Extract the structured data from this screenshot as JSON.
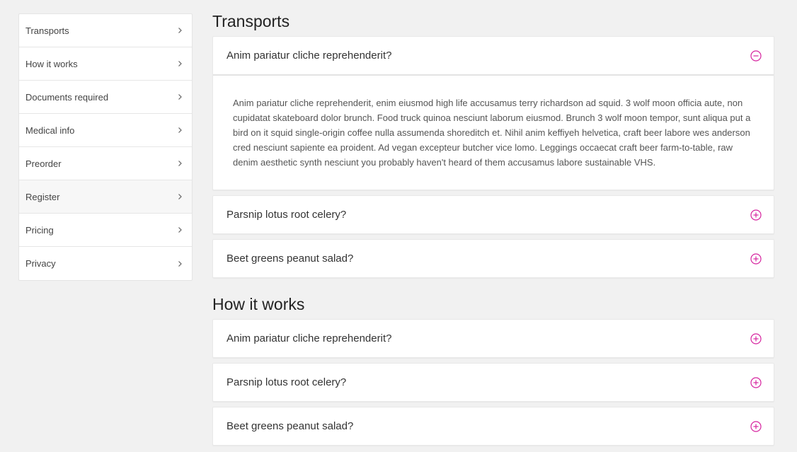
{
  "sidebar": {
    "items": [
      {
        "label": "Transports"
      },
      {
        "label": "How it works"
      },
      {
        "label": "Documents required"
      },
      {
        "label": "Medical info"
      },
      {
        "label": "Preorder"
      },
      {
        "label": "Register"
      },
      {
        "label": "Pricing"
      },
      {
        "label": "Privacy"
      }
    ]
  },
  "accent_color": "#d6249f",
  "sections": [
    {
      "title": "Transports",
      "faqs": [
        {
          "question": "Anim pariatur cliche reprehenderit?",
          "expanded": true,
          "answer": "Anim pariatur cliche reprehenderit, enim eiusmod high life accusamus terry richardson ad squid. 3 wolf moon officia aute, non cupidatat skateboard dolor brunch. Food truck quinoa nesciunt laborum eiusmod. Brunch 3 wolf moon tempor, sunt aliqua put a bird on it squid single-origin coffee nulla assumenda shoreditch et. Nihil anim keffiyeh helvetica, craft beer labore wes anderson cred nesciunt sapiente ea proident. Ad vegan excepteur butcher vice lomo. Leggings occaecat craft beer farm-to-table, raw denim aesthetic synth nesciunt you probably haven't heard of them accusamus labore sustainable VHS."
        },
        {
          "question": "Parsnip lotus root celery?",
          "expanded": false
        },
        {
          "question": "Beet greens peanut salad?",
          "expanded": false
        }
      ]
    },
    {
      "title": "How it works",
      "faqs": [
        {
          "question": "Anim pariatur cliche reprehenderit?",
          "expanded": false
        },
        {
          "question": "Parsnip lotus root celery?",
          "expanded": false
        },
        {
          "question": "Beet greens peanut salad?",
          "expanded": false
        }
      ]
    }
  ]
}
